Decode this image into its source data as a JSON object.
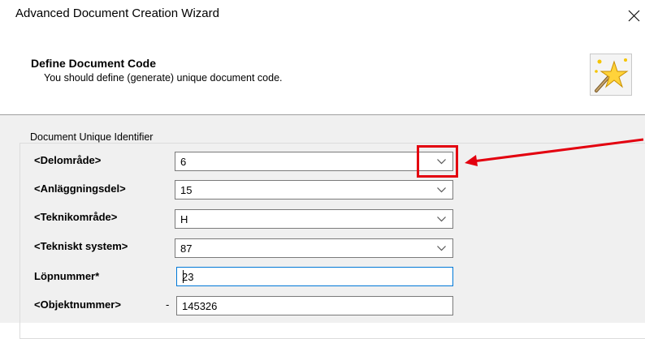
{
  "window": {
    "title": "Advanced Document Creation Wizard",
    "close_glyph": "×"
  },
  "header": {
    "title": "Define Document Code",
    "subtitle": "You should define (generate) unique document code.",
    "icon": "wizard-star-icon"
  },
  "group": {
    "legend": "Document Unique Identifier",
    "rows": [
      {
        "label": "<Delområde>",
        "value": "6",
        "kind": "dropdown"
      },
      {
        "label": "<Anläggningsdel>",
        "value": "15",
        "kind": "dropdown"
      },
      {
        "label": "<Teknikområde>",
        "value": "H",
        "kind": "dropdown"
      },
      {
        "label": "<Tekniskt system>",
        "value": "87",
        "kind": "dropdown"
      },
      {
        "label": "Löpnummer*",
        "value": "23",
        "kind": "text",
        "focused": true
      },
      {
        "label": "<Objektnummer>",
        "prefix": "-",
        "value": "145326",
        "kind": "text"
      }
    ]
  },
  "annotation": {
    "color": "#e3000f",
    "target": "delomrade-dropdown-chevron"
  }
}
